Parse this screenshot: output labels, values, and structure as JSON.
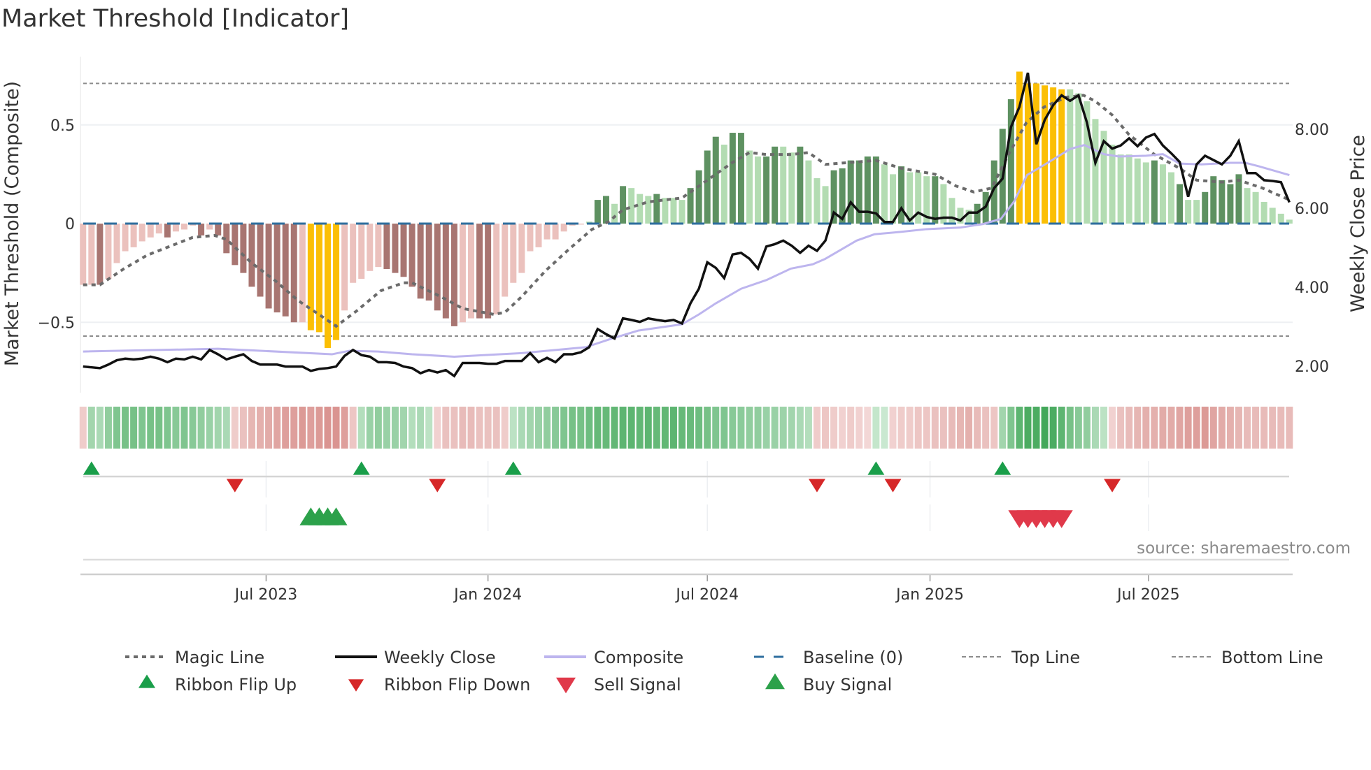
{
  "title": "Market Threshold [Indicator]",
  "source": "source: sharemaestro.com",
  "colors": {
    "bar_light_neg": "#ebc1bd",
    "bar_dark_neg": "#a87571",
    "bar_light_pos": "#b3dcb2",
    "bar_dark_pos": "#5e9161",
    "bar_extreme": "#fbbf05",
    "magic": "#6b6b6b",
    "close": "#111111",
    "composite": "#bdb5ee",
    "baseline": "#2e6e9e",
    "threshold": "#8c8c8c",
    "flip_up": "#1a9e4a",
    "flip_down": "#d62728",
    "buy": "#2ca14a",
    "sell": "#e0394a"
  },
  "chart_data": {
    "type": "bar+line",
    "title": "Market Threshold [Indicator]",
    "ylabel_left": "Market Threshold (Composite)",
    "ylabel_right": "Weekly Close Price",
    "left_ticks": [
      {
        "v": 0.5,
        "label": "0.5"
      },
      {
        "v": 0,
        "label": "0"
      },
      {
        "v": -0.5,
        "label": "−0.5"
      }
    ],
    "right_ticks": [
      {
        "v": 8,
        "label": "8.00"
      },
      {
        "v": 6,
        "label": "6.00"
      },
      {
        "v": 4,
        "label": "4.00"
      },
      {
        "v": 2,
        "label": "2.00"
      }
    ],
    "x_ticks": [
      {
        "week": 22.7,
        "label": "Jul 2023"
      },
      {
        "week": 49.0,
        "label": "Jan 2024"
      },
      {
        "week": 75.0,
        "label": "Jul 2024"
      },
      {
        "week": 101.4,
        "label": "Jan 2025"
      },
      {
        "week": 127.3,
        "label": "Jul 2025"
      }
    ],
    "weeks": 144,
    "top_line": 0.71,
    "bottom_line": -0.57,
    "baseline": 0,
    "composite_bars": [
      -0.31,
      -0.31,
      -0.31,
      -0.28,
      -0.2,
      -0.14,
      -0.12,
      -0.09,
      -0.07,
      -0.05,
      -0.07,
      -0.04,
      -0.03,
      -0.01,
      -0.06,
      -0.03,
      -0.06,
      -0.15,
      -0.21,
      -0.25,
      -0.32,
      -0.37,
      -0.43,
      -0.45,
      -0.47,
      -0.5,
      -0.5,
      -0.54,
      -0.55,
      -0.63,
      -0.59,
      -0.44,
      -0.3,
      -0.28,
      -0.24,
      -0.22,
      -0.23,
      -0.25,
      -0.27,
      -0.32,
      -0.38,
      -0.39,
      -0.44,
      -0.48,
      -0.52,
      -0.5,
      -0.48,
      -0.48,
      -0.48,
      -0.46,
      -0.37,
      -0.3,
      -0.25,
      -0.14,
      -0.12,
      -0.08,
      -0.08,
      -0.04,
      -0.01,
      -0.005,
      0.01,
      0.12,
      0.14,
      0.1,
      0.19,
      0.18,
      0.15,
      0.14,
      0.15,
      0.13,
      0.13,
      0.12,
      0.18,
      0.27,
      0.37,
      0.44,
      0.4,
      0.46,
      0.46,
      0.37,
      0.34,
      0.34,
      0.39,
      0.39,
      0.36,
      0.39,
      0.32,
      0.23,
      0.19,
      0.27,
      0.28,
      0.32,
      0.32,
      0.34,
      0.34,
      0.3,
      0.25,
      0.29,
      0.26,
      0.26,
      0.24,
      0.24,
      0.2,
      0.13,
      0.08,
      0.07,
      0.1,
      0.16,
      0.32,
      0.48,
      0.63,
      0.77,
      0.71,
      0.71,
      0.7,
      0.69,
      0.68,
      0.68,
      0.66,
      0.62,
      0.53,
      0.47,
      0.4,
      0.35,
      0.35,
      0.33,
      0.31,
      0.32,
      0.3,
      0.26,
      0.2,
      0.12,
      0.12,
      0.16,
      0.24,
      0.22,
      0.2,
      0.25,
      0.18,
      0.16,
      0.11,
      0.08,
      0.05,
      0.02
    ],
    "bar_shades": "LLDLLLLLLLDLLLDLDDDDDDDDDDLYYYYLLLLLDDDDDDDDDLLDDLLLLLLLLLLLLDDLDLLLDLLLDDDDLDDLLDDLLDLLLDDDDDDLLDLLLDLLLLDDDDDYYYYYYLLLLLLLLLLDLLDLLDDDDDLLLLLL",
    "weekly_close": [
      1.99,
      1.97,
      1.95,
      2.04,
      2.15,
      2.19,
      2.17,
      2.19,
      2.24,
      2.19,
      2.1,
      2.19,
      2.17,
      2.24,
      2.17,
      2.41,
      2.3,
      2.17,
      2.24,
      2.3,
      2.13,
      2.04,
      2.04,
      2.04,
      1.99,
      1.99,
      1.99,
      1.88,
      1.93,
      1.95,
      1.99,
      2.26,
      2.41,
      2.28,
      2.24,
      2.1,
      2.1,
      2.08,
      1.99,
      1.95,
      1.82,
      1.9,
      1.84,
      1.9,
      1.75,
      2.08,
      2.08,
      2.08,
      2.06,
      2.06,
      2.13,
      2.13,
      2.13,
      2.33,
      2.1,
      2.21,
      2.1,
      2.3,
      2.3,
      2.35,
      2.48,
      2.94,
      2.81,
      2.7,
      3.21,
      3.17,
      3.12,
      3.21,
      3.17,
      3.14,
      3.17,
      3.08,
      3.59,
      3.96,
      4.63,
      4.49,
      4.23,
      4.83,
      4.87,
      4.72,
      4.47,
      5.03,
      5.09,
      5.18,
      5.05,
      4.87,
      5.05,
      4.92,
      5.18,
      5.89,
      5.73,
      6.15,
      5.91,
      5.91,
      5.87,
      5.65,
      5.65,
      6.0,
      5.69,
      5.89,
      5.78,
      5.73,
      5.76,
      5.76,
      5.69,
      5.89,
      5.89,
      6.04,
      6.51,
      6.75,
      8.06,
      8.57,
      9.43,
      7.62,
      8.24,
      8.61,
      8.86,
      8.72,
      8.86,
      8.17,
      7.15,
      7.7,
      7.51,
      7.59,
      7.77,
      7.57,
      7.79,
      7.88,
      7.59,
      7.39,
      7.17,
      6.29,
      7.11,
      7.33,
      7.22,
      7.11,
      7.33,
      7.7,
      6.89,
      6.89,
      6.71,
      6.69,
      6.66,
      6.15
    ],
    "magic_line": [
      [
        1,
        -0.31
      ],
      [
        3,
        -0.31
      ],
      [
        5.8,
        -0.23
      ],
      [
        8.6,
        -0.16
      ],
      [
        11,
        -0.12
      ],
      [
        14,
        -0.07
      ],
      [
        16.6,
        -0.06
      ],
      [
        18,
        -0.08
      ],
      [
        21,
        -0.2
      ],
      [
        23.8,
        -0.29
      ],
      [
        26.5,
        -0.39
      ],
      [
        29.3,
        -0.47
      ],
      [
        31,
        -0.52
      ],
      [
        33.5,
        -0.44
      ],
      [
        36.3,
        -0.34
      ],
      [
        39,
        -0.3
      ],
      [
        40,
        -0.3
      ],
      [
        43.4,
        -0.37
      ],
      [
        46,
        -0.43
      ],
      [
        49.7,
        -0.46
      ],
      [
        51,
        -0.45
      ],
      [
        53,
        -0.37
      ],
      [
        55.8,
        -0.24
      ],
      [
        58.6,
        -0.13
      ],
      [
        61.3,
        -0.03
      ],
      [
        63.3,
        0.01
      ],
      [
        65,
        0.07
      ],
      [
        68,
        0.11
      ],
      [
        72,
        0.13
      ],
      [
        75,
        0.22
      ],
      [
        78,
        0.31
      ],
      [
        80,
        0.36
      ],
      [
        82,
        0.35
      ],
      [
        85,
        0.35
      ],
      [
        87,
        0.36
      ],
      [
        89,
        0.3
      ],
      [
        92,
        0.31
      ],
      [
        95,
        0.32
      ],
      [
        98,
        0.28
      ],
      [
        102,
        0.25
      ],
      [
        104.5,
        0.19
      ],
      [
        106.6,
        0.16
      ],
      [
        108.7,
        0.18
      ],
      [
        110.7,
        0.35
      ],
      [
        112.8,
        0.51
      ],
      [
        114.9,
        0.59
      ],
      [
        117.5,
        0.64
      ],
      [
        119.6,
        0.65
      ],
      [
        121,
        0.62
      ],
      [
        123,
        0.55
      ],
      [
        125,
        0.45
      ],
      [
        128,
        0.35
      ],
      [
        131,
        0.28
      ],
      [
        133,
        0.22
      ],
      [
        136,
        0.21
      ],
      [
        138,
        0.22
      ],
      [
        140.8,
        0.18
      ],
      [
        144,
        0.12
      ]
    ],
    "composite_line": [
      [
        1,
        2.37
      ],
      [
        17,
        2.44
      ],
      [
        21,
        2.4
      ],
      [
        30.5,
        2.3
      ],
      [
        32.6,
        2.39
      ],
      [
        36,
        2.37
      ],
      [
        40,
        2.3
      ],
      [
        45,
        2.24
      ],
      [
        53,
        2.33
      ],
      [
        60.6,
        2.48
      ],
      [
        63.7,
        2.7
      ],
      [
        66.8,
        2.9
      ],
      [
        72,
        3.06
      ],
      [
        74,
        3.31
      ],
      [
        76,
        3.59
      ],
      [
        79,
        3.96
      ],
      [
        82,
        4.18
      ],
      [
        84.9,
        4.47
      ],
      [
        87.5,
        4.58
      ],
      [
        89,
        4.72
      ],
      [
        92.7,
        5.18
      ],
      [
        94.8,
        5.34
      ],
      [
        97.9,
        5.4
      ],
      [
        101,
        5.47
      ],
      [
        105,
        5.51
      ],
      [
        107.7,
        5.6
      ],
      [
        109.8,
        5.73
      ],
      [
        111.4,
        6.18
      ],
      [
        112.9,
        6.84
      ],
      [
        115.5,
        7.17
      ],
      [
        118,
        7.5
      ],
      [
        119.7,
        7.6
      ],
      [
        122,
        7.37
      ],
      [
        123.8,
        7.31
      ],
      [
        127,
        7.33
      ],
      [
        129,
        7.37
      ],
      [
        131,
        7.13
      ],
      [
        133.6,
        7.11
      ],
      [
        137,
        7.15
      ],
      [
        138.8,
        7.15
      ],
      [
        140.4,
        7.06
      ],
      [
        144,
        6.84
      ]
    ],
    "ribbon": [
      -0.2,
      0.35,
      0.3,
      0.45,
      0.55,
      0.6,
      0.6,
      0.55,
      0.6,
      0.6,
      0.55,
      0.5,
      0.55,
      0.5,
      0.45,
      0.4,
      0.35,
      0.3,
      -0.2,
      -0.3,
      -0.4,
      -0.45,
      -0.5,
      -0.55,
      -0.6,
      -0.6,
      -0.65,
      -0.6,
      -0.65,
      -0.7,
      -0.7,
      -0.6,
      -0.25,
      0.25,
      0.4,
      0.45,
      0.4,
      0.4,
      0.35,
      0.25,
      0.3,
      0.2,
      -0.15,
      -0.3,
      -0.3,
      -0.35,
      -0.35,
      -0.3,
      -0.3,
      -0.3,
      -0.2,
      0.2,
      0.3,
      0.35,
      0.4,
      0.45,
      0.5,
      0.55,
      0.6,
      0.6,
      0.65,
      0.7,
      0.7,
      0.72,
      0.75,
      0.75,
      0.72,
      0.75,
      0.7,
      0.72,
      0.75,
      0.7,
      0.68,
      0.65,
      0.6,
      0.55,
      0.55,
      0.5,
      0.48,
      0.45,
      0.45,
      0.4,
      0.4,
      0.38,
      0.35,
      0.3,
      0.25,
      -0.2,
      -0.25,
      -0.2,
      -0.15,
      -0.2,
      -0.15,
      -0.1,
      0.15,
      0.12,
      -0.15,
      -0.2,
      -0.2,
      -0.25,
      -0.25,
      -0.3,
      -0.3,
      -0.35,
      -0.4,
      -0.45,
      -0.35,
      -0.3,
      -0.25,
      0.35,
      0.55,
      0.75,
      0.85,
      0.85,
      0.9,
      0.85,
      0.75,
      0.6,
      0.5,
      0.45,
      0.3,
      0.2,
      -0.15,
      -0.3,
      -0.35,
      -0.4,
      -0.45,
      -0.45,
      -0.5,
      -0.5,
      -0.55,
      -0.6,
      -0.6,
      -0.65,
      -0.55,
      -0.5,
      -0.45,
      -0.4,
      -0.35,
      -0.35,
      -0.35,
      -0.35,
      -0.35,
      -0.35
    ],
    "ribbon_flip_up_weeks": [
      2,
      34,
      52,
      95,
      110
    ],
    "ribbon_flip_down_weeks": [
      19,
      43,
      88,
      97,
      123
    ],
    "buy_signal_weeks": [
      28,
      29,
      30,
      31
    ],
    "sell_signal_weeks": [
      112,
      113,
      114,
      115,
      116,
      117
    ],
    "legend": {
      "placement": "bottom",
      "items": [
        {
          "key": "magic",
          "label": "Magic Line"
        },
        {
          "key": "close",
          "label": "Weekly Close"
        },
        {
          "key": "composite",
          "label": "Composite"
        },
        {
          "key": "baseline",
          "label": "Baseline (0)"
        },
        {
          "key": "top",
          "label": "Top Line"
        },
        {
          "key": "bottom",
          "label": "Bottom Line"
        },
        {
          "key": "flip_up",
          "label": "Ribbon Flip Up"
        },
        {
          "key": "flip_down",
          "label": "Ribbon Flip Down"
        },
        {
          "key": "sell",
          "label": "Sell Signal"
        },
        {
          "key": "buy",
          "label": "Buy Signal"
        }
      ]
    }
  }
}
